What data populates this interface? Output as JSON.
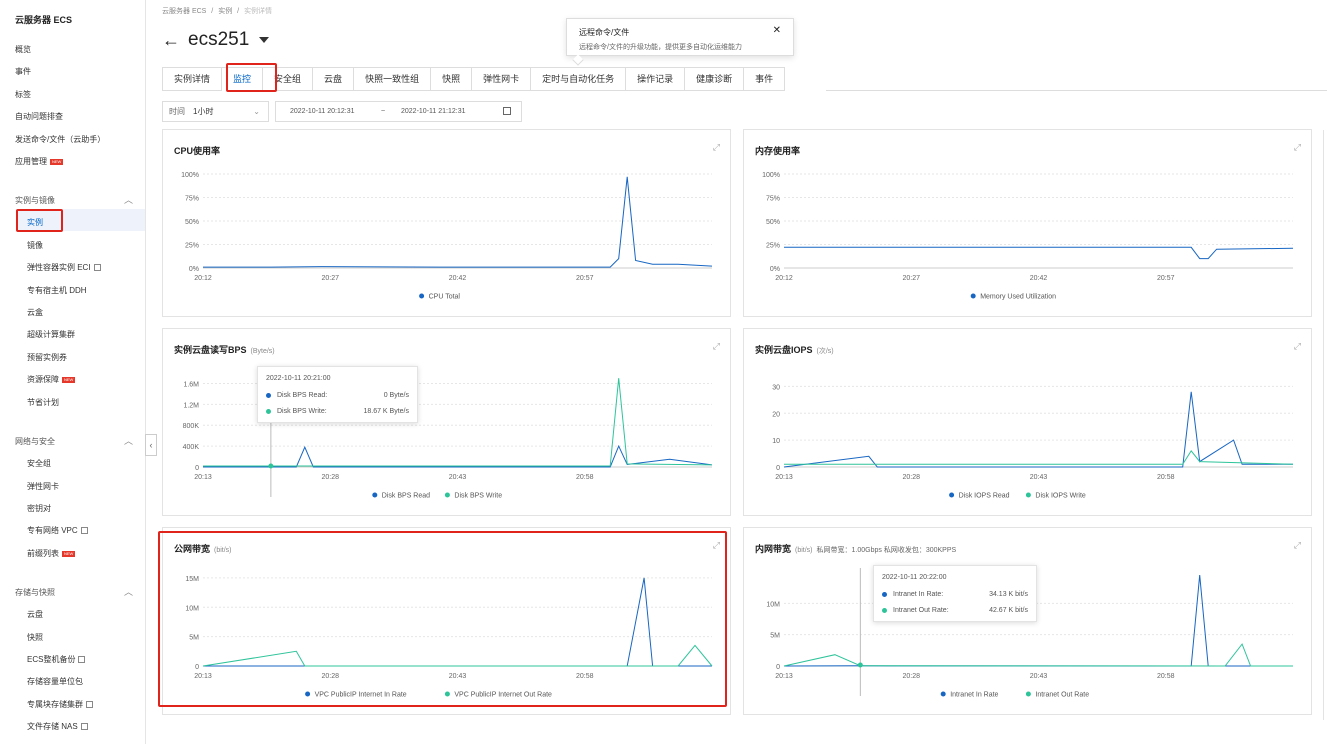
{
  "colors": {
    "blue": "#1766c3",
    "green": "#2ec49a",
    "accent": "#0064c8",
    "highlight": "#e0241b"
  },
  "sidebar": {
    "title": "云服务器 ECS",
    "top_items": [
      "概览",
      "事件",
      "标签",
      "自动问题排查",
      "发送命令/文件（云助手）",
      "应用管理"
    ],
    "new_badge": "NEW",
    "group1": "实例与镜像",
    "group1_items": [
      "实例",
      "镜像",
      "弹性容器实例 ECI",
      "专有宿主机 DDH",
      "云盒",
      "超级计算集群",
      "预留实例券",
      "资源保障",
      "节省计划"
    ],
    "group2": "网络与安全",
    "group2_items": [
      "安全组",
      "弹性网卡",
      "密钥对",
      "专有网络 VPC",
      "前缀列表"
    ],
    "group3": "存储与快照",
    "group3_items": [
      "云盘",
      "快照",
      "ECS整机备份",
      "存储容量单位包",
      "专属块存储集群",
      "文件存储 NAS"
    ]
  },
  "breadcrumb": [
    "云服务器 ECS",
    "/",
    "实例",
    "/",
    "实例详情"
  ],
  "instance_name": "ecs251",
  "popup": {
    "title": "远程命令/文件",
    "desc": "远程命令/文件的升级功能，提供更多自动化运维能力"
  },
  "tabs": [
    "实例详情",
    "监控",
    "安全组",
    "云盘",
    "快照一致性组",
    "快照",
    "弹性网卡",
    "定时与自动化任务",
    "操作记录",
    "健康诊断",
    "事件"
  ],
  "time": {
    "label": "时间",
    "value": "1小时",
    "start": "2022-10-11 20:12:31",
    "sep": "~",
    "end": "2022-10-11 21:12:31"
  },
  "charts": [
    {
      "title": "CPU使用率",
      "unit": "",
      "extra": "",
      "yticks": [
        "100%",
        "75%",
        "50%",
        "25%",
        "0%"
      ],
      "xticks": [
        "20:12",
        "20:27",
        "20:42",
        "20:57"
      ],
      "legend": [
        {
          "name": "CPU Total",
          "color": "blue"
        }
      ]
    },
    {
      "title": "内存使用率",
      "unit": "",
      "extra": "",
      "yticks": [
        "100%",
        "75%",
        "50%",
        "25%",
        "0%"
      ],
      "xticks": [
        "20:12",
        "20:27",
        "20:42",
        "20:57"
      ],
      "legend": [
        {
          "name": "Memory Used Utilization",
          "color": "blue"
        }
      ]
    },
    {
      "title": "实例云盘读写BPS",
      "unit": "(Byte/s)",
      "extra": "",
      "yticks": [
        "1.6M",
        "1.2M",
        "800K",
        "400K",
        "0"
      ],
      "xticks": [
        "20:13",
        "20:28",
        "20:43",
        "20:58"
      ],
      "legend": [
        {
          "name": "Disk BPS Read",
          "color": "blue"
        },
        {
          "name": "Disk BPS Write",
          "color": "green"
        }
      ]
    },
    {
      "title": "实例云盘IOPS",
      "unit": "(次/s)",
      "extra": "",
      "yticks": [
        "30",
        "20",
        "10",
        "0"
      ],
      "xticks": [
        "20:13",
        "20:28",
        "20:43",
        "20:58"
      ],
      "legend": [
        {
          "name": "Disk IOPS Read",
          "color": "blue"
        },
        {
          "name": "Disk IOPS Write",
          "color": "green"
        }
      ]
    },
    {
      "title": "公网带宽",
      "unit": "(bit/s)",
      "extra": "",
      "yticks": [
        "15M",
        "10M",
        "5M",
        "0"
      ],
      "xticks": [
        "20:13",
        "20:28",
        "20:43",
        "20:58"
      ],
      "legend": [
        {
          "name": "VPC PublicIP Internet In Rate",
          "color": "blue"
        },
        {
          "name": "VPC PublicIP Internet Out Rate",
          "color": "green"
        }
      ]
    },
    {
      "title": "内网带宽",
      "unit": "(bit/s)",
      "extra": "私网带宽：1.00Gbps 私网收发包：300KPPS",
      "yticks": [
        "10M",
        "5M",
        "0"
      ],
      "xticks": [
        "20:13",
        "20:28",
        "20:43",
        "20:58"
      ],
      "legend": [
        {
          "name": "Intranet In Rate",
          "color": "blue"
        },
        {
          "name": "Intranet Out Rate",
          "color": "green"
        }
      ]
    }
  ],
  "tooltips": [
    {
      "time": "2022-10-11 20:21:00",
      "rows": [
        {
          "name": "Disk BPS Read:",
          "value": "0 Byte/s",
          "color": "blue"
        },
        {
          "name": "Disk BPS Write:",
          "value": "18.67 K Byte/s",
          "color": "green"
        }
      ]
    },
    {
      "time": "2022-10-11 20:22:00",
      "rows": [
        {
          "name": "Intranet In Rate:",
          "value": "34.13 K bit/s",
          "color": "blue"
        },
        {
          "name": "Intranet Out Rate:",
          "value": "42.67 K bit/s",
          "color": "green"
        }
      ]
    }
  ],
  "chart_data": [
    {
      "type": "line",
      "title": "CPU使用率",
      "ylabel": "",
      "ylim": [
        0,
        100
      ],
      "x_range": [
        "20:12",
        "21:12"
      ],
      "series": [
        {
          "name": "CPU Total",
          "points": [
            [
              "20:12",
              1
            ],
            [
              "20:20",
              1
            ],
            [
              "20:26",
              1.5
            ],
            [
              "20:40",
              1
            ],
            [
              "21:00",
              1
            ],
            [
              "21:01",
              10
            ],
            [
              "21:02",
              97
            ],
            [
              "21:03",
              8
            ],
            [
              "21:05",
              4
            ],
            [
              "21:08",
              4
            ],
            [
              "21:12",
              2
            ]
          ]
        }
      ]
    },
    {
      "type": "line",
      "title": "内存使用率",
      "ylabel": "",
      "ylim": [
        0,
        100
      ],
      "x_range": [
        "20:12",
        "21:12"
      ],
      "series": [
        {
          "name": "Memory Used Utilization",
          "points": [
            [
              "20:12",
              22
            ],
            [
              "21:00",
              22
            ],
            [
              "21:01",
              10
            ],
            [
              "21:02",
              10
            ],
            [
              "21:03",
              20
            ],
            [
              "21:12",
              21
            ]
          ]
        }
      ]
    },
    {
      "type": "line",
      "title": "实例云盘读写BPS",
      "ylabel": "Byte/s",
      "ylim": [
        0,
        1800000
      ],
      "x_range": [
        "20:13",
        "21:13"
      ],
      "series": [
        {
          "name": "Disk BPS Read",
          "points": [
            [
              "20:13",
              0
            ],
            [
              "20:24",
              0
            ],
            [
              "20:25",
              380000
            ],
            [
              "20:26",
              0
            ],
            [
              "21:01",
              0
            ],
            [
              "21:02",
              400000
            ],
            [
              "21:03",
              50000
            ],
            [
              "21:08",
              150000
            ],
            [
              "21:13",
              40000
            ]
          ]
        },
        {
          "name": "Disk BPS Write",
          "points": [
            [
              "20:13",
              20000
            ],
            [
              "20:21",
              18670
            ],
            [
              "21:01",
              20000
            ],
            [
              "21:02",
              1700000
            ],
            [
              "21:03",
              60000
            ],
            [
              "21:13",
              40000
            ]
          ]
        }
      ]
    },
    {
      "type": "line",
      "title": "实例云盘IOPS",
      "ylabel": "次/s",
      "ylim": [
        0,
        35
      ],
      "x_range": [
        "20:13",
        "21:13"
      ],
      "series": [
        {
          "name": "Disk IOPS Read",
          "points": [
            [
              "20:13",
              0
            ],
            [
              "20:23",
              4
            ],
            [
              "20:24",
              0
            ],
            [
              "21:00",
              0
            ],
            [
              "21:01",
              28
            ],
            [
              "21:02",
              2
            ],
            [
              "21:06",
              10
            ],
            [
              "21:07",
              1
            ],
            [
              "21:13",
              1
            ]
          ]
        },
        {
          "name": "Disk IOPS Write",
          "points": [
            [
              "20:13",
              1
            ],
            [
              "21:00",
              1
            ],
            [
              "21:01",
              6
            ],
            [
              "21:02",
              2
            ],
            [
              "21:13",
              1
            ]
          ]
        }
      ]
    },
    {
      "type": "line",
      "title": "公网带宽",
      "ylabel": "bit/s",
      "ylim": [
        0,
        16000000
      ],
      "x_range": [
        "20:13",
        "21:13"
      ],
      "series": [
        {
          "name": "VPC PublicIP Internet In Rate",
          "points": [
            [
              "20:13",
              0
            ],
            [
              "21:03",
              0
            ],
            [
              "21:05",
              15000000
            ],
            [
              "21:06",
              0
            ],
            [
              "21:13",
              0
            ]
          ]
        },
        {
          "name": "VPC PublicIP Internet Out Rate",
          "points": [
            [
              "20:13",
              0
            ],
            [
              "20:24",
              2500000
            ],
            [
              "20:25",
              0
            ],
            [
              "21:09",
              0
            ],
            [
              "21:11",
              3500000
            ],
            [
              "21:13",
              0
            ]
          ]
        }
      ]
    },
    {
      "type": "line",
      "title": "内网带宽",
      "ylabel": "bit/s",
      "ylim": [
        0,
        15000000
      ],
      "x_range": [
        "20:13",
        "21:13"
      ],
      "series": [
        {
          "name": "Intranet In Rate",
          "points": [
            [
              "20:13",
              0
            ],
            [
              "20:22",
              34130
            ],
            [
              "21:01",
              0
            ],
            [
              "21:02",
              14500000
            ],
            [
              "21:03",
              0
            ],
            [
              "21:13",
              0
            ]
          ]
        },
        {
          "name": "Intranet Out Rate",
          "points": [
            [
              "20:13",
              0
            ],
            [
              "20:19",
              1800000
            ],
            [
              "20:22",
              42670
            ],
            [
              "21:05",
              0
            ],
            [
              "21:07",
              3500000
            ],
            [
              "21:08",
              0
            ],
            [
              "21:13",
              0
            ]
          ]
        }
      ]
    }
  ]
}
